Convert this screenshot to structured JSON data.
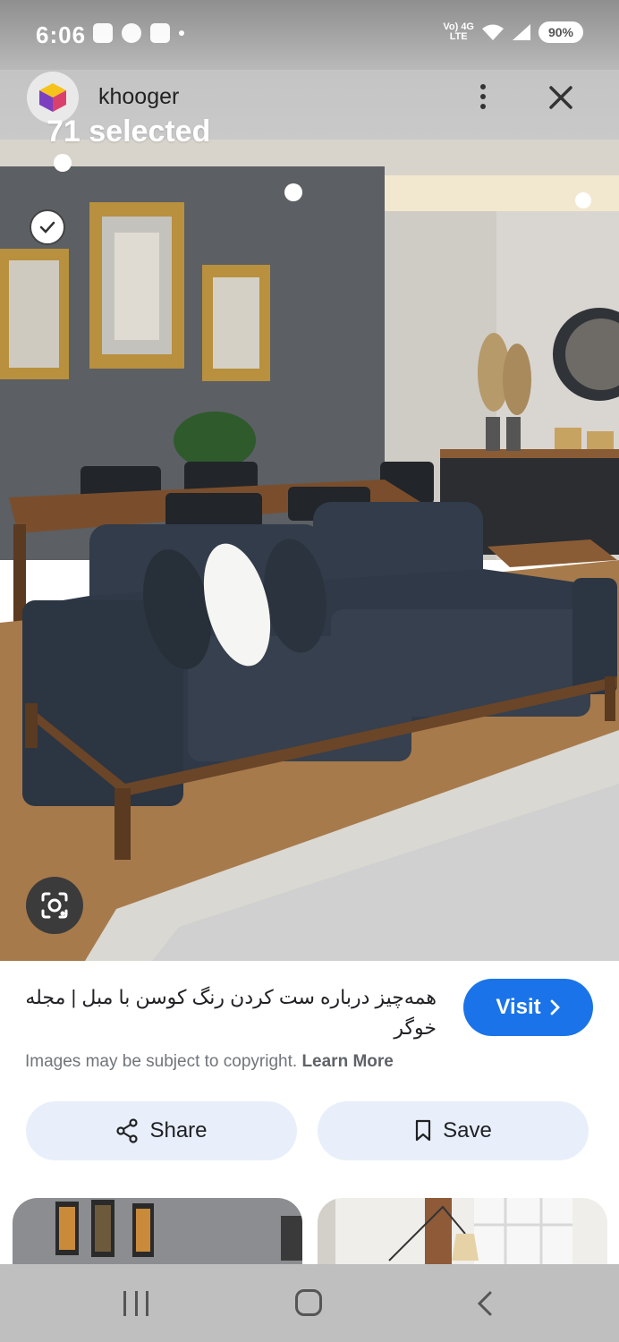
{
  "status_bar": {
    "time": "6:06",
    "network_top": "Vo) 4G",
    "network_bottom": "LTE",
    "battery": "90%"
  },
  "header": {
    "site_name": "khooger",
    "selected_count": "71 selected",
    "icons": [
      "more-vert-icon",
      "close-icon",
      "site-logo-icon"
    ]
  },
  "result": {
    "title": "همه‌چیز درباره ست کردن رنگ کوسن با مبل | مجله خوگر",
    "visit_label": "Visit",
    "copyright_text": "Images may be subject to copyright.",
    "learn_more": "Learn More"
  },
  "actions": {
    "share_label": "Share",
    "save_label": "Save"
  },
  "colors": {
    "accent": "#1a73e8",
    "action_bg": "#e8effa",
    "sofa": "#2f3947",
    "wall": "#5c5f63"
  }
}
